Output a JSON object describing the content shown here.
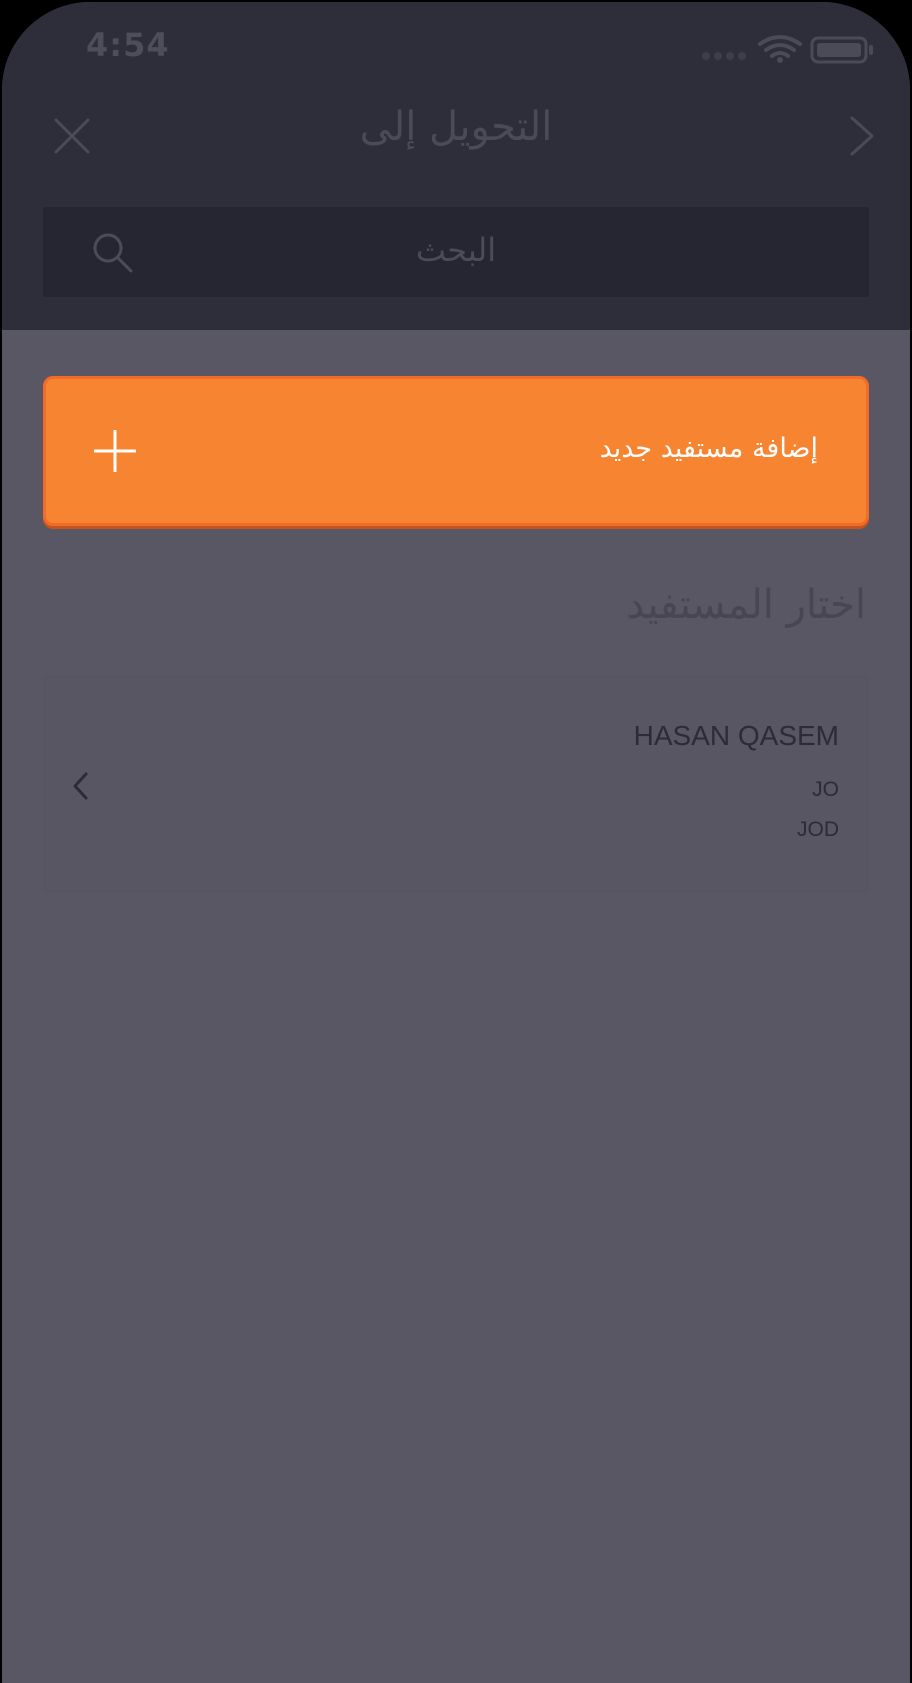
{
  "status_bar": {
    "time": "4:54",
    "icons": [
      "signal-dots-icon",
      "wifi-icon",
      "battery-icon"
    ]
  },
  "nav": {
    "title": "التحويل إلى",
    "close_icon": "close-icon",
    "forward_icon": "chevron-right-icon"
  },
  "search": {
    "placeholder": "البحث",
    "icon": "search-icon"
  },
  "add_beneficiary": {
    "label": "إضافة مستفيد جديد",
    "icon": "plus-icon"
  },
  "section": {
    "title": "اختار المستفيد"
  },
  "beneficiaries": [
    {
      "name": "HASAN QASEM",
      "country": "JO",
      "currency": "JOD"
    }
  ],
  "colors": {
    "header_bg": "#2e2d3a",
    "body_bg": "#585763",
    "accent": "#f78431"
  }
}
